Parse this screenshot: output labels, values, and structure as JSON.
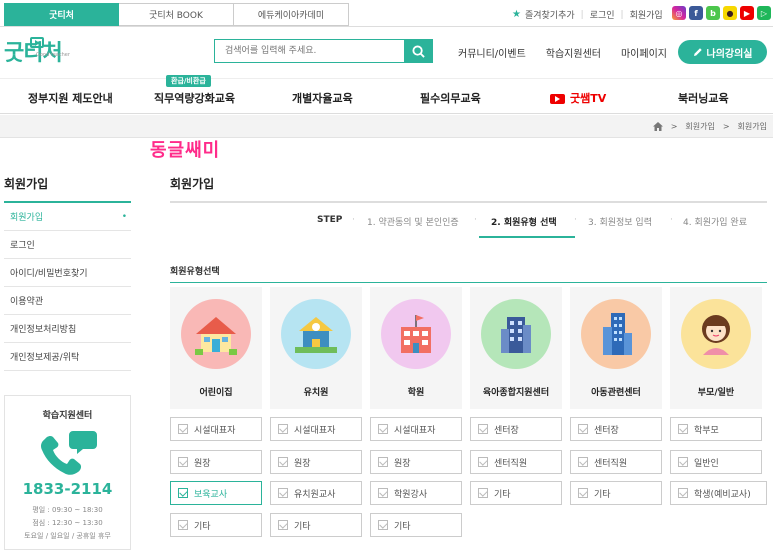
{
  "topbar": {
    "tabs": [
      "굿티처",
      "굿티처 BOOK",
      "에듀케이아카데미"
    ],
    "links": [
      "즐겨찾기추가",
      "로그인",
      "회원가입"
    ]
  },
  "header": {
    "logo": "굿티처",
    "logo_sub": "Good teacher",
    "search_placeholder": "검색어를 입력해 주세요.",
    "links": [
      "커뮤니티/이벤트",
      "학습지원센터",
      "마이페이지"
    ],
    "my_lecture": "나의강의실"
  },
  "gnb": {
    "badge": "환급/비환급",
    "items": [
      "정부지원 제도안내",
      "직무역량강화교육",
      "개별자율교육",
      "필수의무교육",
      "굿쌤TV",
      "북러닝교육"
    ]
  },
  "breadcrumb": [
    "회원가입",
    "회원가입"
  ],
  "watermark": "동글쌔미",
  "sidebar": {
    "title": "회원가입",
    "items": [
      "회원가입",
      "로그인",
      "아이디/비밀번호찾기",
      "이용약관",
      "개인정보처리방침",
      "개인정보제공/위탁"
    ],
    "center": {
      "title": "학습지원센터",
      "phone": "1833-2114",
      "hours": [
        "평일 : 09:30 ~ 18:30",
        "점심 : 12:30 ~ 13:30",
        "토요일 / 일요일 / 공휴일 휴무"
      ]
    }
  },
  "main": {
    "title": "회원가입",
    "steps": {
      "label": "STEP",
      "items": [
        "1. 약관동의 및 본인인증",
        "2. 회원유형 선택",
        "3. 회원정보 입력",
        "4. 회원가입 완료"
      ]
    },
    "section_title": "회원유형선택",
    "types": [
      {
        "label": "어린이집",
        "options": [
          "시설대표자",
          "원장",
          "보육교사",
          "기타"
        ]
      },
      {
        "label": "유치원",
        "options": [
          "시설대표자",
          "원장",
          "유치원교사",
          "기타"
        ]
      },
      {
        "label": "학원",
        "options": [
          "시설대표자",
          "원장",
          "학원강사",
          "기타"
        ]
      },
      {
        "label": "육아종합지원센터",
        "options": [
          "센터장",
          "센터직원",
          "기타"
        ]
      },
      {
        "label": "아동관련센터",
        "options": [
          "센터장",
          "센터직원",
          "기타"
        ]
      },
      {
        "label": "부모/일반",
        "options": [
          "학부모",
          "일반인",
          "학생(예비교사)"
        ]
      }
    ]
  },
  "colors": {
    "accent": "#2bb39a",
    "watermark": "#ff2b8a",
    "youtube": "#e00000"
  }
}
